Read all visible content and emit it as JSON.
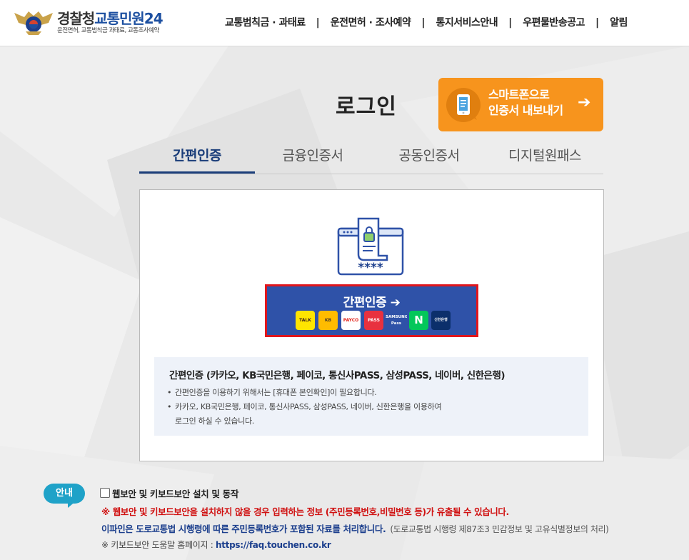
{
  "header": {
    "logo_title_1": "경찰청",
    "logo_title_2": "교통민원24",
    "logo_subtitle": "운전면허, 교통범칙금 과태료, 교통조사예약",
    "nav": [
      "교통범칙금 · 과태료",
      "운전면허 · 조사예약",
      "통지서비스안내",
      "우편물반송공고",
      "알림"
    ]
  },
  "login": {
    "title": "로그인",
    "export_button_line1": "스마트폰으로",
    "export_button_line2": "인증서 내보내기",
    "export_arrow": "➔"
  },
  "tabs": [
    {
      "label": "간편인증",
      "active": true
    },
    {
      "label": "금융인증서",
      "active": false
    },
    {
      "label": "공동인증서",
      "active": false
    },
    {
      "label": "디지털원패스",
      "active": false
    }
  ],
  "panel": {
    "password_mask": "****",
    "simple_auth_button_label": "간편인증 ➔",
    "providers": [
      {
        "label": "TALK",
        "icon": "kakaotalk-icon",
        "bg": "#fee500",
        "fg": "#3a1d1d"
      },
      {
        "label": "KB",
        "icon": "kb-bank-icon",
        "bg": "#ffbc00",
        "fg": "#4a3b2a"
      },
      {
        "label": "PAYCO",
        "icon": "payco-icon",
        "bg": "#ffffff",
        "fg": "#e2231a"
      },
      {
        "label": "PASS",
        "icon": "pass-icon",
        "bg": "#e8313f",
        "fg": "#ffffff"
      },
      {
        "label": "SAMSUNG Pass",
        "icon": "samsung-pass-icon",
        "bg": "#2f52a8",
        "fg": "#ffffff"
      },
      {
        "label": "N",
        "icon": "naver-icon",
        "bg": "#03c75a",
        "fg": "#ffffff"
      },
      {
        "label": "신한은행",
        "icon": "shinhan-bank-icon",
        "bg": "#0b2f6b",
        "fg": "#ffffff"
      }
    ],
    "info_title": "간편인증 (카카오, KB국민은행, 페이코, 통신사PASS, 삼성PASS, 네이버, 신한은행)",
    "info_item1": "간편인증을 이용하기 위해서는 [휴대폰 본인확인]이 필요합니다.",
    "info_item2_line1": "카카오, KB국민은행, 페이코, 통신사PASS, 삼성PASS, 네이버, 신한은행을 이용하여",
    "info_item2_line2": "로그인 하실 수 있습니다."
  },
  "notice": {
    "badge": "안내",
    "checkbox_label": "웹보안 및 키보드보안 설치 및 동작",
    "warning": "※ 웹보안 및 키보드보안을 설치하지 않을 경우 입력하는 정보 (주민등록번호,비밀번호 등)가 유출될 수 있습니다.",
    "privacy_main": "이파인은 도로교통법 시행령에 따른 주민등록번호가 포함된 자료를 처리합니다.",
    "privacy_note": "(도로교통법 시행령 제87조3 민감정보 및 고유식별정보의 처리)",
    "help_prefix": "※ 키보드보안 도움말 홈페이지 : ",
    "help_url": "https://faq.touchen.co.kr"
  },
  "colors": {
    "accent_navy": "#1b3e7a",
    "button_blue": "#2f52a8",
    "export_orange": "#f7941d",
    "warning_red": "#d01010",
    "badge_cyan": "#1fa2c8"
  }
}
